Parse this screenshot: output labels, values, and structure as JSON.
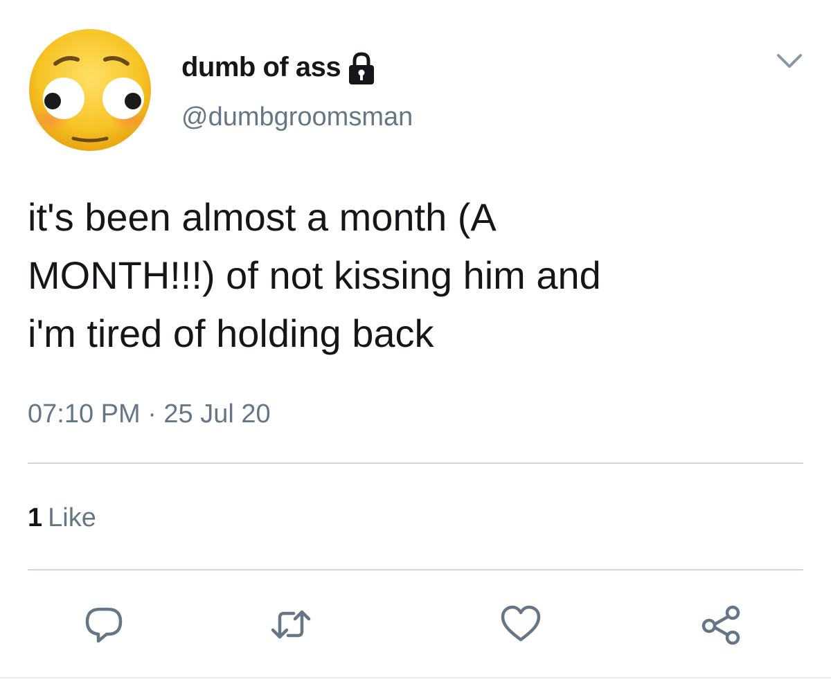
{
  "tweet": {
    "author": {
      "display_name": "dumb of ass",
      "handle": "@dumbgroomsman",
      "avatar_icon": "flushed-face-icon",
      "protected_icon": "lock-icon"
    },
    "text": "it's been almost a month (A\nMONTH!!!) of not kissing him and\ni'm tired of holding back",
    "timestamp": "07:10 PM · 25 Jul 20",
    "stats": {
      "like_count": "1",
      "like_label": "Like"
    },
    "actions": [
      {
        "icon": "reply-icon"
      },
      {
        "icon": "retweet-icon"
      },
      {
        "icon": "heart-icon"
      },
      {
        "icon": "share-icon"
      }
    ],
    "menu_icon": "chevron-down-icon",
    "colors": {
      "text_primary": "#14171a",
      "text_secondary": "#657786",
      "divider": "#ccd6dd",
      "avatar_yellow": "#f4c534"
    }
  }
}
